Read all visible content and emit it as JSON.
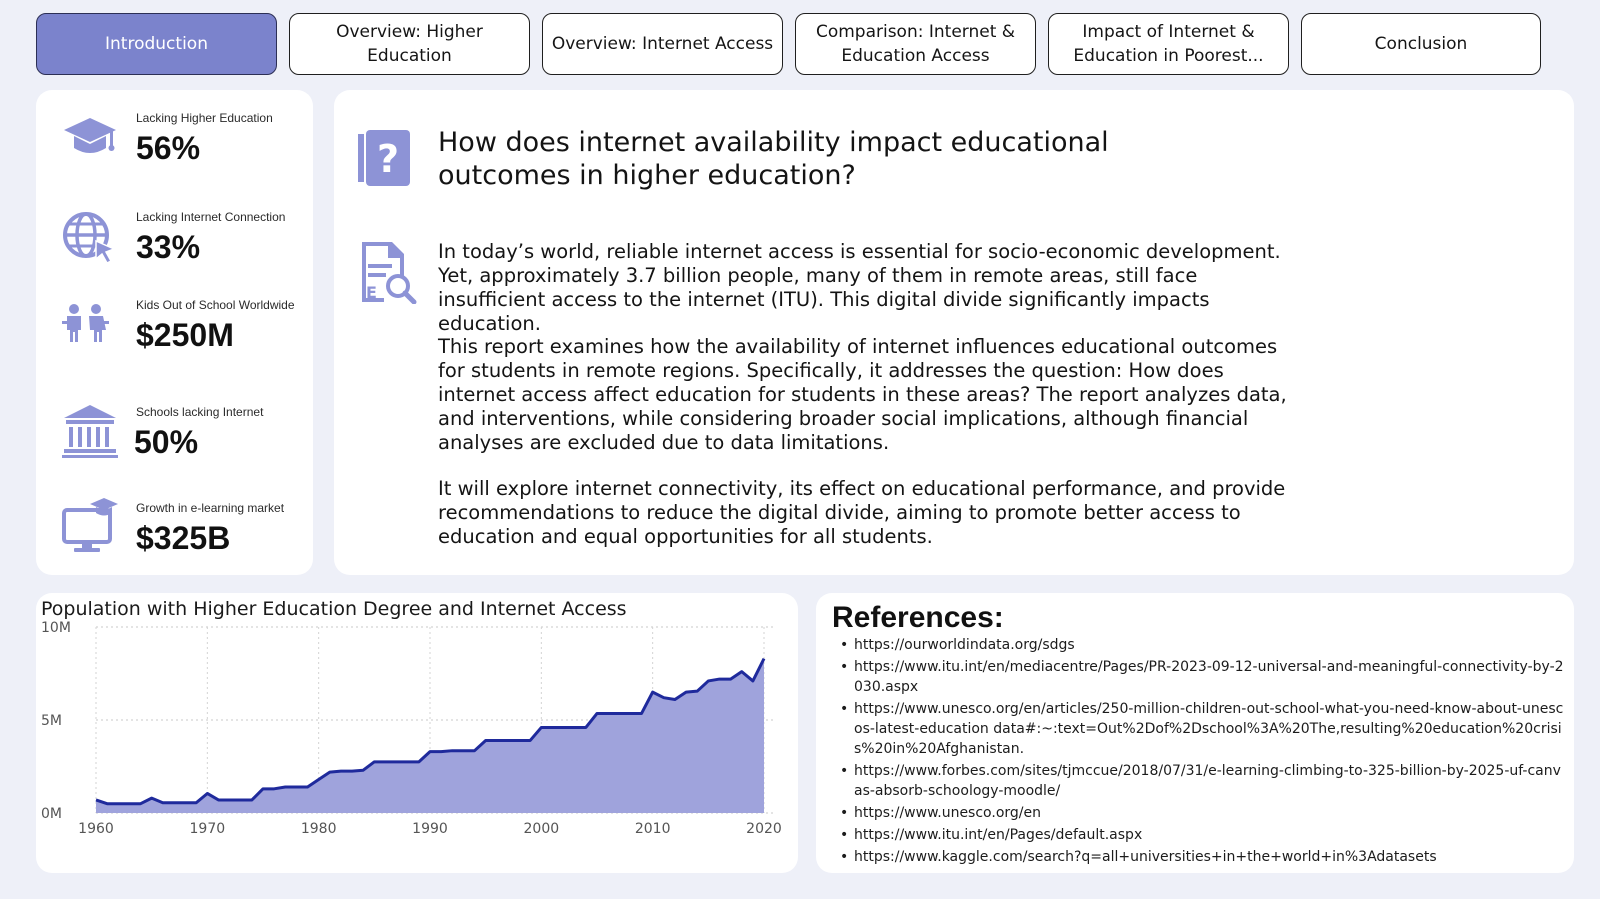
{
  "tabs": [
    {
      "label": "Introduction",
      "active": true
    },
    {
      "label": "Overview: Higher Education",
      "active": false
    },
    {
      "label": "Overview: Internet Access",
      "active": false
    },
    {
      "label": "Comparison: Internet & Education Access",
      "active": false
    },
    {
      "label": "Impact of Internet & Education in Poorest...",
      "active": false
    },
    {
      "label": "Conclusion",
      "active": false
    }
  ],
  "kpis": [
    {
      "label": "Lacking Higher Education",
      "value": "56%",
      "icon": "graduation-cap-icon"
    },
    {
      "label": "Lacking Internet Connection",
      "value": "33%",
      "icon": "globe-cursor-icon"
    },
    {
      "label": "Kids Out of School Worldwide",
      "value": "$250M",
      "icon": "children-icon"
    },
    {
      "label": "Schools lacking Internet",
      "value": "50%",
      "icon": "school-building-icon"
    },
    {
      "label": "Growth in e-learning market",
      "value": "$325B",
      "icon": "computer-learning-icon"
    }
  ],
  "intro": {
    "question": "How does internet availability impact educational outcomes in higher education?",
    "paragraphs": [
      "In today’s world, reliable internet access is essential for socio-economic development. Yet, approximately 3.7 billion people, many of them in remote areas, still face insufficient access to the internet (ITU). This digital divide significantly impacts education.",
      "This report examines how the availability of internet influences educational outcomes for students in remote regions. Specifically, it addresses the question: How does internet access affect education for students in these areas? The report analyzes data, and interventions, while considering broader social implications, although financial analyses are excluded due to data limitations.",
      "It will explore internet connectivity, its effect on educational performance, and provide recommendations to reduce the digital divide, aiming to promote better access to education and equal opportunities for all students."
    ]
  },
  "colors": {
    "accent": "#7b83cc",
    "icon": "#8d93d6",
    "line": "#1f2a9c",
    "area": "#9fa3dc"
  },
  "chart_data": {
    "type": "area",
    "title": "Population with Higher Education Degree and Internet Access",
    "xlabel": "",
    "ylabel": "",
    "xlim": [
      1960,
      2020
    ],
    "ylim": [
      0,
      10000000
    ],
    "x_ticks": [
      "1960",
      "1970",
      "1980",
      "1990",
      "2000",
      "2010",
      "2020"
    ],
    "y_ticks": [
      "0M",
      "5M",
      "10M"
    ],
    "grid": true,
    "x": [
      1960,
      1961,
      1962,
      1963,
      1964,
      1965,
      1966,
      1967,
      1968,
      1969,
      1970,
      1971,
      1972,
      1973,
      1974,
      1975,
      1976,
      1977,
      1978,
      1979,
      1980,
      1981,
      1982,
      1983,
      1984,
      1985,
      1986,
      1987,
      1988,
      1989,
      1990,
      1991,
      1992,
      1993,
      1994,
      1995,
      1996,
      1997,
      1998,
      1999,
      2000,
      2001,
      2002,
      2003,
      2004,
      2005,
      2006,
      2007,
      2008,
      2009,
      2010,
      2011,
      2012,
      2013,
      2014,
      2015,
      2016,
      2017,
      2018,
      2019,
      2020
    ],
    "series": [
      {
        "values": [
          0.7,
          0.5,
          0.5,
          0.5,
          0.5,
          0.8,
          0.55,
          0.55,
          0.55,
          0.55,
          1.05,
          0.7,
          0.7,
          0.7,
          0.7,
          1.3,
          1.3,
          1.4,
          1.4,
          1.4,
          1.8,
          2.2,
          2.25,
          2.25,
          2.3,
          2.75,
          2.75,
          2.75,
          2.75,
          2.75,
          3.3,
          3.3,
          3.35,
          3.35,
          3.35,
          3.9,
          3.9,
          3.9,
          3.9,
          3.9,
          4.6,
          4.6,
          4.6,
          4.6,
          4.6,
          5.35,
          5.35,
          5.35,
          5.35,
          5.35,
          6.5,
          6.2,
          6.1,
          6.5,
          6.55,
          7.1,
          7.2,
          7.2,
          7.6,
          7.1,
          8.3
        ]
      }
    ]
  },
  "references": {
    "title": "References:",
    "items": [
      "https://ourworldindata.org/sdgs",
      "https://www.itu.int/en/mediacentre/Pages/PR-2023-09-12-universal-and-meaningful-connectivity-by-2030.aspx",
      "https://www.unesco.org/en/articles/250-million-children-out-school-what-you-need-know-about-unescos-latest-education data#:~:text=Out%2Dof%2Dschool%3A%20The,resulting%20education%20crisis%20in%20Afghanistan.",
      "https://www.forbes.com/sites/tjmccue/2018/07/31/e-learning-climbing-to-325-billion-by-2025-uf-canvas-absorb-schoology-moodle/",
      "https://www.unesco.org/en",
      "https://www.itu.int/en/Pages/default.aspx",
      "https://www.kaggle.com/search?q=all+universities+in+the+world+in%3Adatasets"
    ]
  }
}
